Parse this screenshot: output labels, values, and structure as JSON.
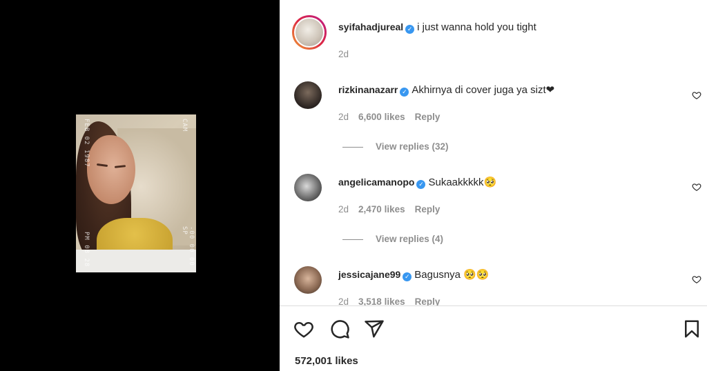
{
  "post": {
    "author": "syifahadjureal",
    "caption": "i just wanna hold you tight",
    "time": "2d",
    "likes": "572,001 likes",
    "photo_stamps": {
      "date": "FEB 02 1987",
      "cam": "CAM",
      "time": "PM 08 28",
      "side": "-00 00 00 SP"
    }
  },
  "comments": [
    {
      "username": "rizkinanazarr",
      "text": "Akhirnya di cover juga ya sizt❤",
      "time": "2d",
      "likes": "6,600 likes",
      "reply": "Reply",
      "view_replies": "View replies (32)"
    },
    {
      "username": "angelicamanopo",
      "text": "Sukaakkkkk🥺",
      "time": "2d",
      "likes": "2,470 likes",
      "reply": "Reply",
      "view_replies": "View replies (4)"
    },
    {
      "username": "jessicajane99",
      "text": "Bagusnya 🥺🥺",
      "time": "2d",
      "likes": "3,518 likes",
      "reply": "Reply"
    }
  ],
  "icons": [
    "heart-icon",
    "comment-icon",
    "share-icon",
    "bookmark-icon",
    "verified-badge-icon"
  ],
  "colors": {
    "verified": "#3897f0",
    "muted": "#8e8e8e",
    "text": "#262626",
    "story_ring_start": "#f09433",
    "story_ring_end": "#bc1888"
  }
}
